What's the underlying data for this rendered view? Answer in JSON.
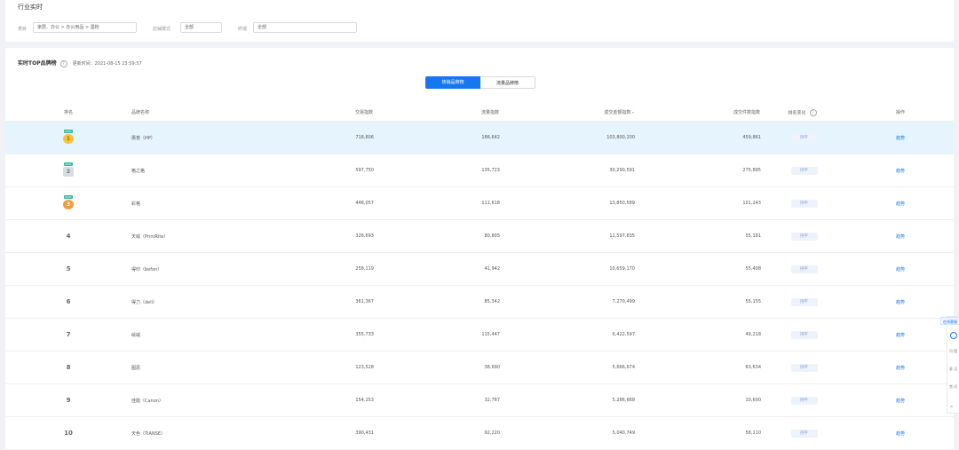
{
  "page_title": "行业实时",
  "filters": {
    "category_label": "类目",
    "category_value": "家居、办公 > 办公用品 > 墨粉",
    "store_type_label": "店铺模式",
    "store_type_value": "全部",
    "terminal_label": "终端",
    "terminal_value": "全部"
  },
  "ranking": {
    "title": "实时TOP品牌榜",
    "updated_label": "更新时间：2021-08-15 23:59:57",
    "tabs": [
      "热销品牌榜",
      "流量品牌榜"
    ],
    "columns": [
      "排名",
      "品牌名称",
      "交易指数",
      "流量指数",
      "成交金额指数",
      "成交件数指数",
      "排名变化",
      "操作"
    ],
    "sort_indicator": "▾",
    "rows": [
      {
        "rank": "1",
        "medal": "gold",
        "year": "2021",
        "name": "惠普（HP）",
        "trade": "718,806",
        "flow": "186,642",
        "amount": "103,800,200",
        "count": "459,861",
        "change": "持平",
        "op": "趋势"
      },
      {
        "rank": "2",
        "medal": "silver",
        "year": "2021",
        "name": "格之格",
        "trade": "597,750",
        "flow": "135,723",
        "amount": "30,290,591",
        "count": "275,895",
        "change": "持平",
        "op": "趋势"
      },
      {
        "rank": "3",
        "medal": "bronze",
        "year": "2021",
        "name": "彩格",
        "trade": "448,057",
        "flow": "111,618",
        "amount": "13,850,589",
        "count": "101,243",
        "change": "持平",
        "op": "趋势"
      },
      {
        "rank": "4",
        "medal": "",
        "year": "",
        "name": "天威（PrintRite）",
        "trade": "326,693",
        "flow": "80,805",
        "amount": "11,597,835",
        "count": "55,181",
        "change": "持平",
        "op": "趋势"
      },
      {
        "rank": "5",
        "medal": "",
        "year": "",
        "name": "得印（befon）",
        "trade": "258,119",
        "flow": "41,942",
        "amount": "10,659,170",
        "count": "55,408",
        "change": "持平",
        "op": "趋势"
      },
      {
        "rank": "6",
        "medal": "",
        "year": "",
        "name": "得力（deli）",
        "trade": "361,367",
        "flow": "85,342",
        "amount": "7,270,499",
        "count": "55,155",
        "change": "持平",
        "op": "趋势"
      },
      {
        "rank": "7",
        "medal": "",
        "year": "",
        "name": "绘威",
        "trade": "355,733",
        "flow": "115,447",
        "amount": "6,422,597",
        "count": "49,218",
        "change": "持平",
        "op": "趋势"
      },
      {
        "rank": "8",
        "medal": "",
        "year": "",
        "name": "图思",
        "trade": "123,528",
        "flow": "38,690",
        "amount": "5,666,674",
        "count": "63,634",
        "change": "持平",
        "op": "趋势"
      },
      {
        "rank": "9",
        "medal": "",
        "year": "",
        "name": "佳能（Canon）",
        "trade": "154,253",
        "flow": "32,787",
        "amount": "5,286,668",
        "count": "10,600",
        "change": "持平",
        "op": "趋势"
      },
      {
        "rank": "10",
        "medal": "",
        "year": "",
        "name": "天色（TIANSE）",
        "trade": "390,431",
        "flow": "92,220",
        "amount": "5,040,749",
        "count": "58,110",
        "change": "持平",
        "op": "趋势"
      }
    ]
  },
  "floater": {
    "tab": "在线客服",
    "lines": [
      "问\n题",
      "意\n见",
      "常\n问"
    ],
    "arrow": "↗"
  }
}
